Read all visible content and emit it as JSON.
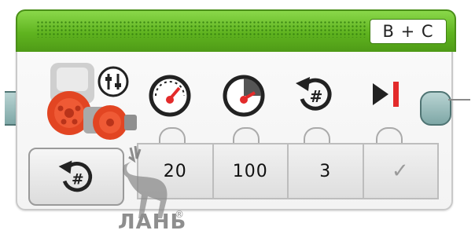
{
  "block": {
    "port_label": "B + C",
    "header_color": "#5fb31f",
    "mode_icon": "rotations-hash-icon",
    "motor_icon": "large-motor-pair-icon",
    "parameters": [
      {
        "icon": "steering-icon",
        "value": "20"
      },
      {
        "icon": "power-icon",
        "value": "100"
      },
      {
        "icon": "rotations-icon",
        "value": "3"
      },
      {
        "icon": "brake-icon",
        "value": "✓"
      }
    ]
  },
  "watermark": {
    "text": "ЛАНЬ",
    "registered": "®"
  }
}
